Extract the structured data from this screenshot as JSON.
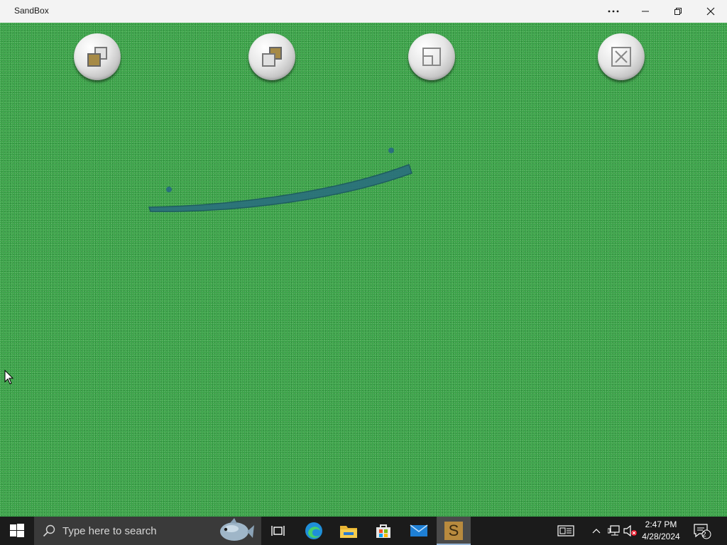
{
  "window": {
    "title": "SandBox"
  },
  "toolbar": {
    "buttons": [
      {
        "name": "bring-to-front"
      },
      {
        "name": "send-to-back"
      },
      {
        "name": "resize"
      },
      {
        "name": "delete"
      }
    ]
  },
  "taskbar": {
    "search_placeholder": "Type here to search",
    "time": "2:47 PM",
    "date": "4/28/2024",
    "notification_count": "2",
    "active_app_letter": "S"
  },
  "colors": {
    "canvas": "#3aa348",
    "stick": "#2a6f7d",
    "taskbar": "#1b1b1b"
  }
}
